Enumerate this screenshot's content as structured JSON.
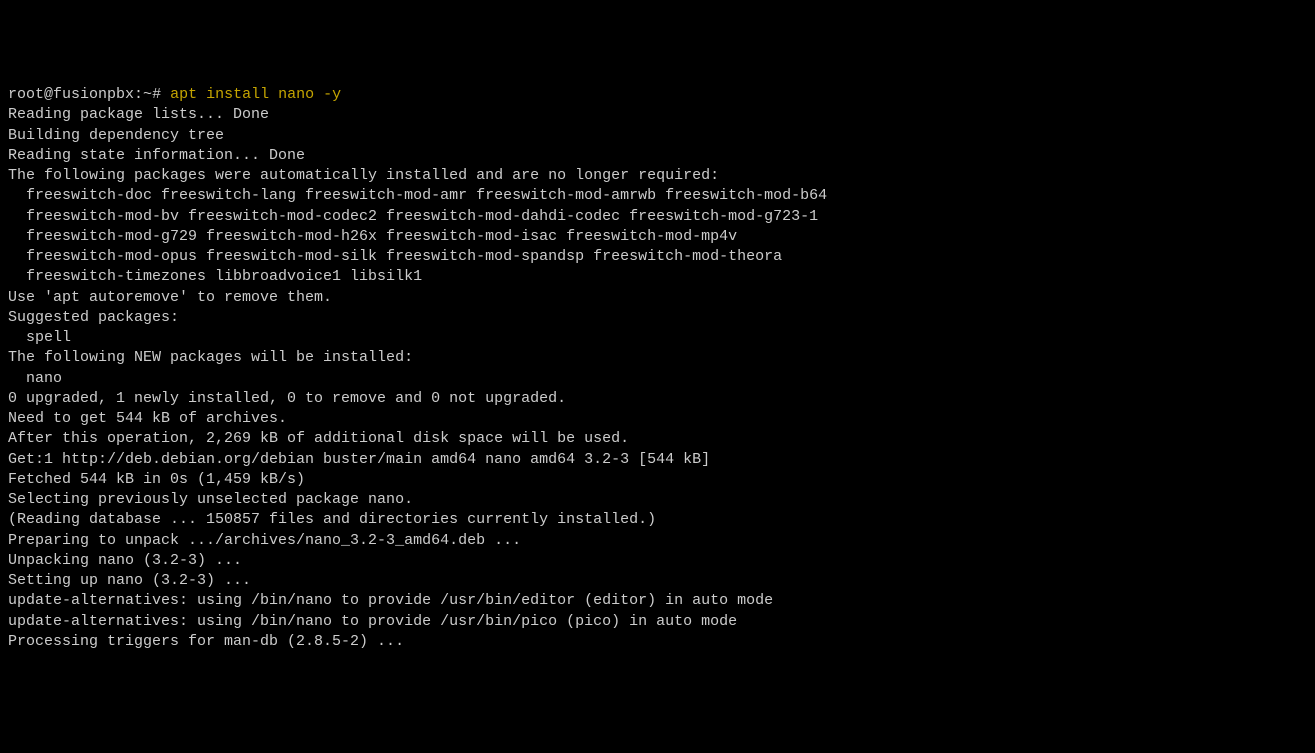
{
  "prompt": {
    "user_host": "root@fusionpbx",
    "path": "~",
    "symbol": "#",
    "command": "apt install nano -y"
  },
  "output": {
    "l01": "Reading package lists... Done",
    "l02": "Building dependency tree",
    "l03": "Reading state information... Done",
    "l04": "The following packages were automatically installed and are no longer required:",
    "l05": "  freeswitch-doc freeswitch-lang freeswitch-mod-amr freeswitch-mod-amrwb freeswitch-mod-b64",
    "l06": "  freeswitch-mod-bv freeswitch-mod-codec2 freeswitch-mod-dahdi-codec freeswitch-mod-g723-1",
    "l07": "  freeswitch-mod-g729 freeswitch-mod-h26x freeswitch-mod-isac freeswitch-mod-mp4v",
    "l08": "  freeswitch-mod-opus freeswitch-mod-silk freeswitch-mod-spandsp freeswitch-mod-theora",
    "l09": "  freeswitch-timezones libbroadvoice1 libsilk1",
    "l10": "Use 'apt autoremove' to remove them.",
    "l11": "Suggested packages:",
    "l12": "  spell",
    "l13": "The following NEW packages will be installed:",
    "l14": "  nano",
    "l15": "0 upgraded, 1 newly installed, 0 to remove and 0 not upgraded.",
    "l16": "Need to get 544 kB of archives.",
    "l17": "After this operation, 2,269 kB of additional disk space will be used.",
    "l18": "Get:1 http://deb.debian.org/debian buster/main amd64 nano amd64 3.2-3 [544 kB]",
    "l19": "Fetched 544 kB in 0s (1,459 kB/s)",
    "l20": "Selecting previously unselected package nano.",
    "l21": "(Reading database ... 150857 files and directories currently installed.)",
    "l22": "Preparing to unpack .../archives/nano_3.2-3_amd64.deb ...",
    "l23": "Unpacking nano (3.2-3) ...",
    "l24": "Setting up nano (3.2-3) ...",
    "l25": "update-alternatives: using /bin/nano to provide /usr/bin/editor (editor) in auto mode",
    "l26": "update-alternatives: using /bin/nano to provide /usr/bin/pico (pico) in auto mode",
    "l27": "Processing triggers for man-db (2.8.5-2) ..."
  }
}
